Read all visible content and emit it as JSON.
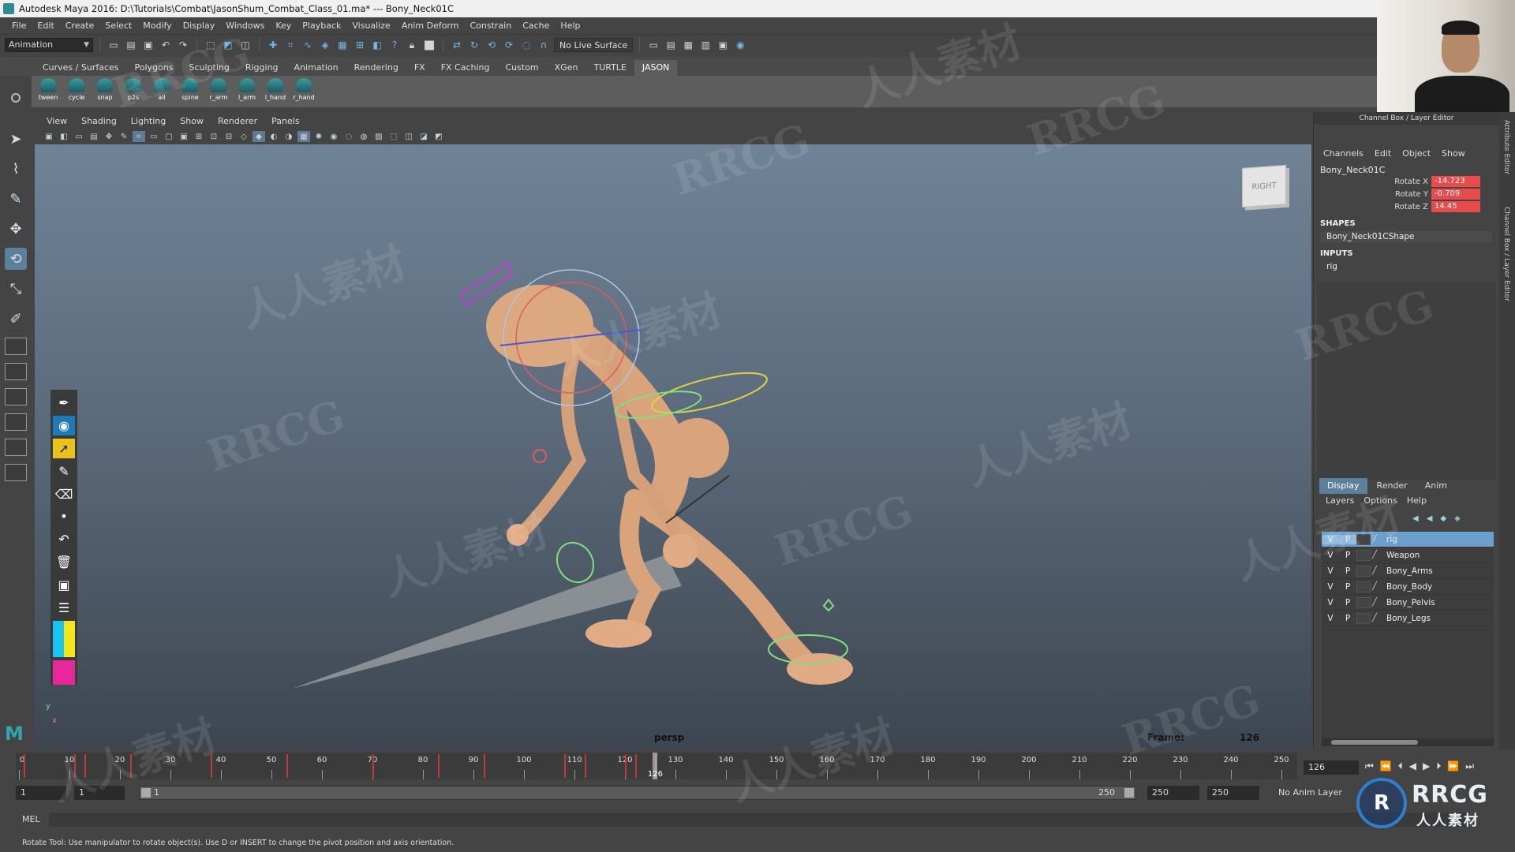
{
  "window": {
    "title": "Autodesk Maya 2016: D:\\Tutorials\\Combat\\JasonShum_Combat_Class_01.ma*  ---  Bony_Neck01C"
  },
  "menubar": [
    "File",
    "Edit",
    "Create",
    "Select",
    "Modify",
    "Display",
    "Windows",
    "Key",
    "Playback",
    "Visualize",
    "Anim Deform",
    "Constrain",
    "Cache",
    "Help"
  ],
  "statusline": {
    "mode": "Animation",
    "live_surface": "No Live Surface"
  },
  "shelf": {
    "tabs": [
      "Curves / Surfaces",
      "Polygons",
      "Sculpting",
      "Rigging",
      "Animation",
      "Rendering",
      "FX",
      "FX Caching",
      "Custom",
      "XGen",
      "TURTLE",
      "JASON"
    ],
    "active_tab": "JASON",
    "buttons": [
      "tween",
      "cycle",
      "snap",
      "p2s",
      "all",
      "spine",
      "r_arm",
      "l_arm",
      "l_hand",
      "r_hand"
    ]
  },
  "panel": {
    "menus": [
      "View",
      "Shading",
      "Lighting",
      "Show",
      "Renderer",
      "Panels"
    ],
    "camera": "persp",
    "frame_label": "Frame:",
    "frame_value": "126",
    "viewcube_label": "RIGHT",
    "axis_y": "y",
    "axis_x": "x"
  },
  "channel_box": {
    "title": "Channel Box / Layer Editor",
    "menus": [
      "Channels",
      "Edit",
      "Object",
      "Show"
    ],
    "object": "Bony_Neck01C",
    "attributes": [
      {
        "name": "Rotate X",
        "value": "-14.723"
      },
      {
        "name": "Rotate Y",
        "value": "-0.709"
      },
      {
        "name": "Rotate Z",
        "value": "14.45"
      }
    ],
    "shapes_header": "SHAPES",
    "shape_node": "Bony_Neck01CShape",
    "inputs_header": "INPUTS",
    "input_node": "rig",
    "side_tabs": [
      "Attribute Editor",
      "Channel Box / Layer Editor"
    ],
    "accent_color": "#e84b4b"
  },
  "layer_editor": {
    "tabs": [
      "Display",
      "Render",
      "Anim"
    ],
    "active_tab": "Display",
    "menus": [
      "Layers",
      "Options",
      "Help"
    ],
    "layers": [
      {
        "v": "V",
        "p": "P",
        "name": "rig",
        "selected": true
      },
      {
        "v": "V",
        "p": "P",
        "name": "Weapon",
        "selected": false
      },
      {
        "v": "V",
        "p": "P",
        "name": "Bony_Arms",
        "selected": false
      },
      {
        "v": "V",
        "p": "P",
        "name": "Bony_Body",
        "selected": false
      },
      {
        "v": "V",
        "p": "P",
        "name": "Bony_Pelvis",
        "selected": false
      },
      {
        "v": "V",
        "p": "P",
        "name": "Bony_Legs",
        "selected": false
      }
    ]
  },
  "timeline": {
    "ticks": [
      "0",
      "10",
      "20",
      "30",
      "40",
      "50",
      "60",
      "70",
      "80",
      "90",
      "100",
      "110",
      "120",
      "130",
      "140",
      "150",
      "160",
      "170",
      "180",
      "190",
      "200",
      "210",
      "220",
      "230",
      "240",
      "250"
    ],
    "range_max": 250,
    "current_frame": "126",
    "frame_field": "126",
    "key_frames": [
      1,
      11,
      13,
      22,
      38,
      53,
      70,
      83,
      92,
      108,
      112,
      120,
      122,
      126
    ]
  },
  "range": {
    "start": "1",
    "playback_start": "1",
    "bar_start": "1",
    "bar_end": "250",
    "playback_end": "250",
    "end": "250",
    "anim_layer": "No Anim Layer"
  },
  "command_line": {
    "language": "MEL"
  },
  "help_line": {
    "text": "Rotate Tool: Use manipulator to rotate object(s). Use D or INSERT to change the pivot position and axis orientation."
  },
  "watermark": {
    "brand": "RRCG",
    "sub": "人人素材",
    "tiles": [
      "RRCG",
      "人人素材"
    ]
  }
}
